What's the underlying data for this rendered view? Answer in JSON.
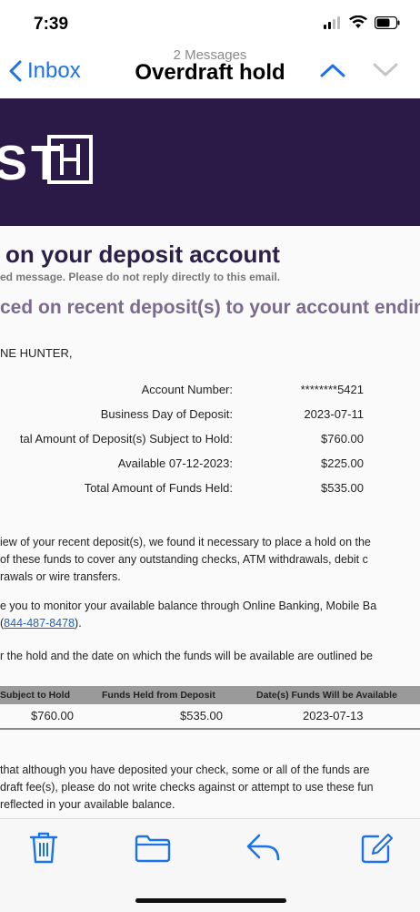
{
  "status_bar": {
    "time": "7:39"
  },
  "nav": {
    "back_label": "Inbox",
    "message_count": "2 Messages",
    "title": "Overdraft hold"
  },
  "email": {
    "logo_text": "ST",
    "heading": "on your deposit account",
    "subnote": "ed message. Please do not reply directly to this email.",
    "subheading": "ced on recent deposit(s) to your account endin",
    "greeting": "NE HUNTER,",
    "details": [
      {
        "label": "Account Number:",
        "value": "********5421"
      },
      {
        "label": "Business Day of Deposit:",
        "value": "2023-07-11"
      },
      {
        "label": "tal Amount of Deposit(s) Subject to Hold:",
        "value": "$760.00"
      },
      {
        "label": "Available 07-12-2023:",
        "value": "$225.00"
      },
      {
        "label": "Total Amount of Funds Held:",
        "value": "$535.00"
      }
    ],
    "para1": [
      "iew of your recent deposit(s), we found it necessary to place a hold on the",
      " of these funds to cover any outstanding checks, ATM withdrawals, debit c",
      "rawals or wire transfers."
    ],
    "para2_line1": "e you to monitor your available balance through Online Banking, Mobile Ba",
    "para2_line2_prefix": "(",
    "phone": "844-487-8478",
    "para2_line2_suffix": ").",
    "para3": "r the hold and the date on which the funds will be available are outlined be",
    "hold_table": {
      "headers": [
        "Subject to Hold",
        "Funds Held from Deposit",
        "Date(s) Funds Will be Available"
      ],
      "row": [
        "$760.00",
        "$535.00",
        "2023-07-13"
      ]
    },
    "para4": [
      "that although you have deposited your check, some or all of the funds are",
      "draft fee(s), please do not write checks against or attempt to use these fun",
      "reflected in your available balance."
    ]
  },
  "toolbar": {
    "icons": [
      "trash-icon",
      "folder-icon",
      "reply-icon",
      "compose-icon"
    ]
  },
  "colors": {
    "accent": "#1a73e8",
    "banner": "#2b1a47",
    "heading": "#2d2048",
    "subheading": "#7a6b8f"
  }
}
